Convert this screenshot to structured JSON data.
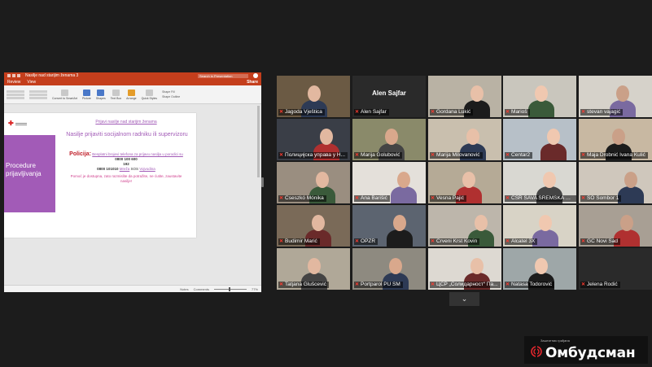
{
  "powerpoint": {
    "title": "Nasilje nad starijim ženama 3",
    "search_placeholder": "Search in Presentation",
    "menu_tabs": [
      "Review",
      "View"
    ],
    "share_label": "Share",
    "ribbon": {
      "convert": "Convert to SmartArt",
      "picture": "Picture",
      "shapes": "Shapes",
      "textbox": "Text Box",
      "arrange": "Arrange",
      "quick_styles": "Quick Styles",
      "shape_fill": "Shape Fill",
      "shape_outline": "Shape Outline"
    },
    "slide": {
      "link_title": "Prijavi nasilje nad starijim ženama",
      "heading": "Nasilje prijaviti socijalnom radniku ili supervizoru",
      "section_label": "Procedure prijavljivanja",
      "policy_label": "Policija:",
      "policy_text": "Besplatni brojevi telefona za prijavu nasilja u porodici su",
      "phone1": "0800 100 600",
      "phone2": "192",
      "phone3_prefix": "0800 101010",
      "phone3_link": "Mreža",
      "phone3_sos": "SOS",
      "phone3_region": "Vojvodina",
      "footer_text": "Pomoć je dostupna, zato razmislite da potražite, ne ćutite, zaustavite nasilje!"
    },
    "status": {
      "notes": "Notes",
      "comments": "Comments",
      "zoom": "77%"
    }
  },
  "participants": [
    "Jagoda Vještica",
    "Alen Sajfar",
    "Gordana Lukić",
    "Marioš",
    "stevan vajagić",
    "Полицијска управа у Н...",
    "Marija Golubović",
    "Marija Milovanović",
    "Centar2",
    "Maja Drobnić Ivana Kulić",
    "Cseszkó Mónika",
    "Ana Barišić",
    "Vesna Pajić",
    "CSR SAVA SREMSKA MI...",
    "SO Sombor 1",
    "Budimir Marić",
    "OPZR",
    "Crveni Krst Kovin",
    "Alcatel 3X",
    "GC Novi Sad",
    "Tatjana Glušcević",
    "Portparol PU SM",
    "ЦСР „Солидарност“ Па...",
    "Natasa Todorović",
    "Jelena Rodić"
  ],
  "center_name": "Alen Sajfar",
  "active_speaker": "Natasa Todorović",
  "more_chevron": "⌄",
  "logo": {
    "small": "Заштитник грађана",
    "main": "Омбудсман",
    "accent": "#e3262d"
  }
}
